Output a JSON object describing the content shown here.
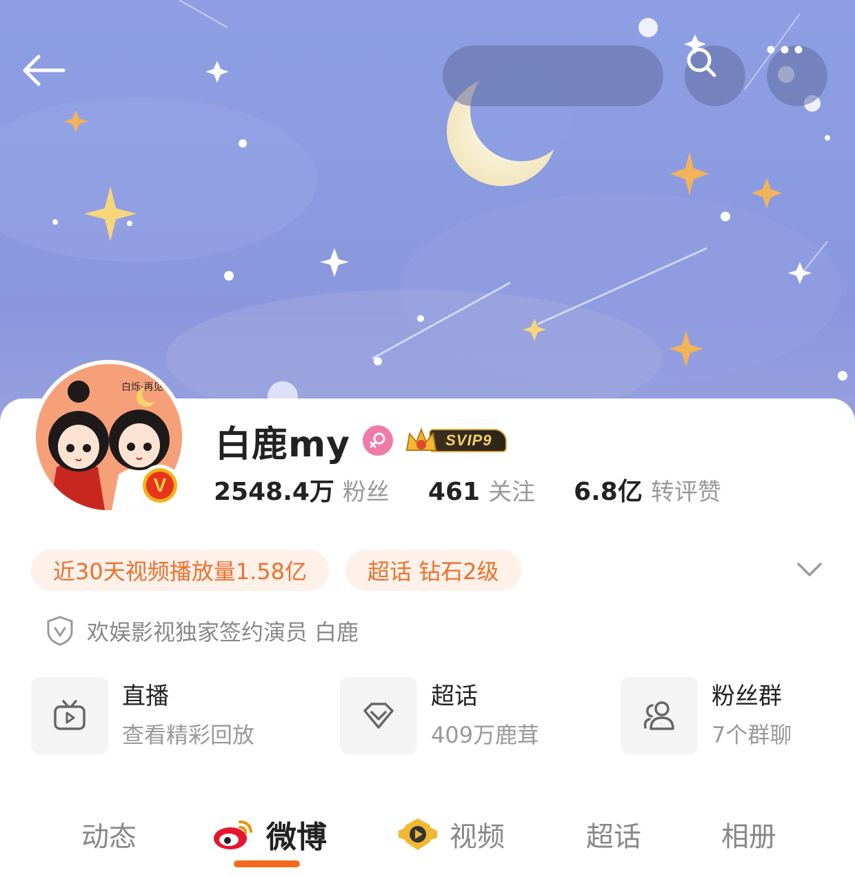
{
  "header": {
    "back_icon": "arrow-left-icon",
    "search_placeholder": "",
    "search_icon": "search-icon",
    "more_icon": "more-dots-icon"
  },
  "profile": {
    "username": "白鹿my",
    "gender_icon": "female-icon",
    "vip_badge": "SVIP9",
    "verified_badge": "V",
    "avatar_caption": "白烁·再见",
    "stats": [
      {
        "value": "2548.4万",
        "label": "粉丝"
      },
      {
        "value": "461",
        "label": "关注"
      },
      {
        "value": "6.8亿",
        "label": "转评赞"
      }
    ],
    "tags": [
      "近30天视频播放量1.58亿",
      "超话 钻石2级"
    ],
    "verification": "欢娱影视独家签约演员 白鹿"
  },
  "features": [
    {
      "title": "直播",
      "subtitle": "查看精彩回放",
      "icon": "tv-play-icon"
    },
    {
      "title": "超话",
      "subtitle": "409万鹿茸",
      "icon": "diamond-icon"
    },
    {
      "title": "粉丝群",
      "subtitle": "7个群聊",
      "icon": "group-users-icon"
    }
  ],
  "tabs": [
    {
      "label": "动态",
      "active": false
    },
    {
      "label": "微博",
      "active": true,
      "icon": "weibo-logo-icon"
    },
    {
      "label": "视频",
      "active": false,
      "icon": "video-play-badge-icon"
    },
    {
      "label": "超话",
      "active": false
    },
    {
      "label": "相册",
      "active": false
    }
  ],
  "colors": {
    "accent": "#f36a1d",
    "tag_text": "#f0702a",
    "tag_bg": "#fdf1ea",
    "cover_sky": "#8d9fe2"
  }
}
